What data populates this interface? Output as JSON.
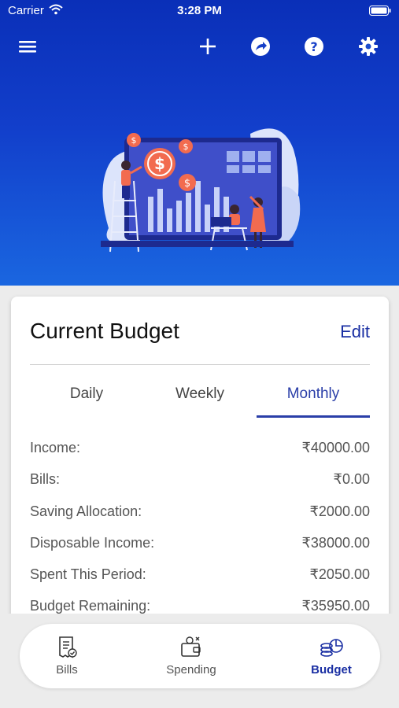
{
  "status_bar": {
    "carrier": "Carrier",
    "time": "3:28 PM"
  },
  "toolbar": {
    "icons": [
      "menu-icon",
      "plus-icon",
      "share-icon",
      "help-icon",
      "settings-icon"
    ]
  },
  "budget_card": {
    "title": "Current Budget",
    "edit_label": "Edit",
    "tabs": [
      {
        "label": "Daily",
        "active": false
      },
      {
        "label": "Weekly",
        "active": false
      },
      {
        "label": "Monthly",
        "active": true
      }
    ],
    "rows": [
      {
        "label": "Income:",
        "value": "₹40000.00"
      },
      {
        "label": "Bills:",
        "value": "₹0.00"
      },
      {
        "label": "Saving Allocation:",
        "value": "₹2000.00"
      },
      {
        "label": "Disposable Income:",
        "value": "₹38000.00"
      },
      {
        "label": "Spent This Period:",
        "value": "₹2050.00"
      },
      {
        "label": "Budget Remaining:",
        "value": "₹35950.00"
      }
    ]
  },
  "tab_bar": {
    "items": [
      {
        "label": "Bills",
        "icon": "bills-icon",
        "active": false
      },
      {
        "label": "Spending",
        "icon": "wallet-icon",
        "active": false
      },
      {
        "label": "Budget",
        "icon": "budget-icon",
        "active": true
      }
    ]
  },
  "colors": {
    "header_blue": "#0a2fb8",
    "accent": "#1a2fa3",
    "coin": "#f26b4f"
  }
}
